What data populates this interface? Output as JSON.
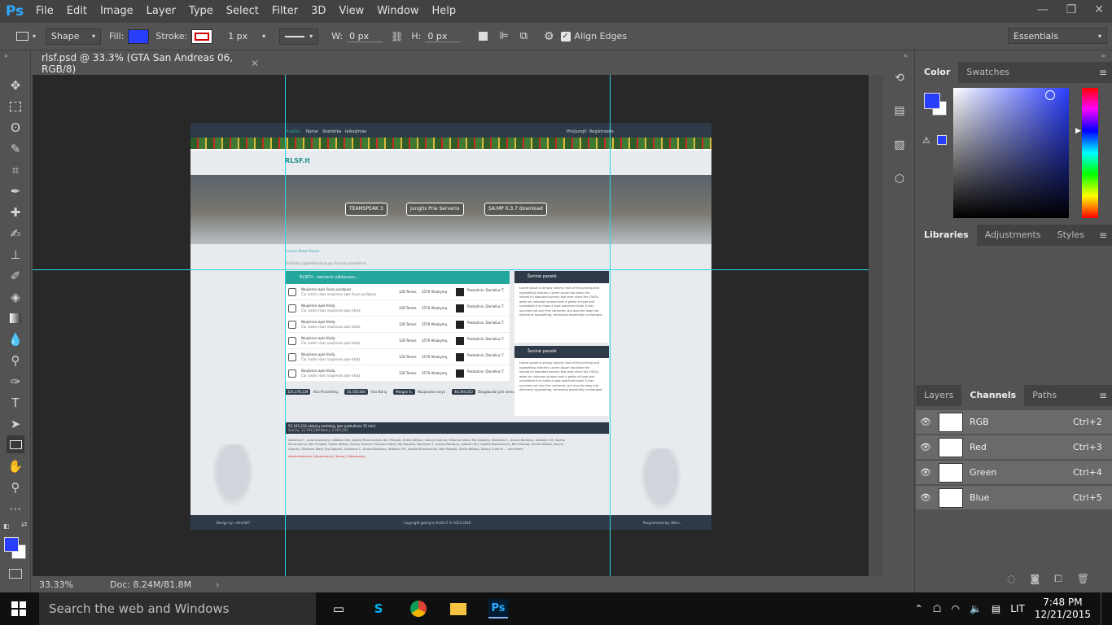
{
  "app": {
    "logo": "Ps",
    "menu": [
      "File",
      "Edit",
      "Image",
      "Layer",
      "Type",
      "Select",
      "Filter",
      "3D",
      "View",
      "Window",
      "Help"
    ]
  },
  "window_controls": {
    "minimize": "—",
    "restore": "❐",
    "close": "✕"
  },
  "options": {
    "tool_mode": "Shape",
    "fill_label": "Fill:",
    "fill_color": "#2a3ffe",
    "stroke_label": "Stroke:",
    "stroke_width": "1 px",
    "w_label": "W:",
    "w_value": "0 px",
    "h_label": "H:",
    "h_value": "0 px",
    "align_edges_label": "Align Edges",
    "workspace": "Essentials"
  },
  "document": {
    "tab_title": "rlsf.psd @ 33.3% (GTA San Andreas 06, RGB/8)",
    "zoom": "33.33%",
    "doc_size": "Doc: 8.24M/81.8M"
  },
  "design": {
    "nav_left": [
      "Pradžia",
      "Nariai",
      "Statistika",
      "Ieškojimas"
    ],
    "nav_right": [
      "Prisijungti",
      "Registruotis"
    ],
    "logo_text": "RLSF.lt",
    "hero_buttons": [
      "TEAMSPEAK 3",
      "Jungtis Prie Serverio",
      "SA:MP 0.3.7 download"
    ],
    "breadcrumb": "Invision Power Board",
    "sub_crumb": "Peržiūrėti pagrindinius/naujus forumo pranešimus",
    "forum_title": "RLSF.lt - serverio užklausos...",
    "forum_rows": [
      {
        "title": "Naujienos apie šiuos puslapius",
        "desc": "Čia rasite visas naujienas apie šiuos puslapius",
        "count": "128 Temos",
        "replies": "2579 Atsakymų",
        "last": "Paskutinis: Danielius T."
      },
      {
        "title": "Naujienos apie tikslą",
        "desc": "Čia rasite visas naujienas apie tikslą",
        "count": "128 Temos",
        "replies": "2579 Atsakymų",
        "last": "Paskutinis: Danielius T."
      },
      {
        "title": "Naujienos apie tikslą",
        "desc": "Čia rasite visas naujienas apie tikslą",
        "count": "128 Temos",
        "replies": "2579 Atsakymų",
        "last": "Paskutinis: Danielius T."
      },
      {
        "title": "Naujienos apie tikslą",
        "desc": "Čia rasite visas naujienas apie tikslą",
        "count": "128 Temos",
        "replies": "2579 Atsakymų",
        "last": "Paskutinis: Danielius T."
      },
      {
        "title": "Naujienos apie tikslą",
        "desc": "Čia rasite visas naujienas apie tikslą",
        "count": "128 Temos",
        "replies": "2579 Atsakymų",
        "last": "Paskutinis: Danielius T."
      },
      {
        "title": "Naujienos apie tikslą",
        "desc": "Čia rasite visas naujienas apie tikslą",
        "count": "128 Temos",
        "replies": "2579 Atsakymų",
        "last": "Paskutinis: Danielius T."
      }
    ],
    "stats": [
      {
        "value": "325,378,129",
        "label": "Viso Pranešimų"
      },
      {
        "value": "35,156,830",
        "label": "Viso Narių"
      },
      {
        "value": "Morgan G.",
        "label": "Naujausias narys"
      },
      {
        "value": "48,294,052",
        "label": "Daugiausiai prie vienu metu"
      }
    ],
    "side_blocks": [
      {
        "title": "Šoninė panelė",
        "body": "Lorem Ipsum is simply dummy text of the printing and typesetting industry. Lorem Ipsum has been the industry's standard dummy text ever since the 1500s, when an unknown printer took a galley of type and scrambled it to make a type specimen book. It has survived not only five centuries, but also the leap into electronic typesetting, remaining essentially unchanged."
      },
      {
        "title": "Šoninė panelė",
        "body": "Lorem Ipsum is simply dummy text of the printing and typesetting industry. Lorem Ipsum has been the industry's standard dummy text ever since the 1500s, when an unknown printer took a galley of type and scrambled it to make a type specimen book. It has survived not only five centuries, but also the leap into electronic typesetting, remaining essentially unchanged."
      }
    ],
    "online_title": "55,105,312 aktyvių vartotojų (per paskutines 15 min)",
    "online_sub": "Svečių: 12,594,289 Narių: 2,993,592",
    "online_body": "Danielius T., Aurora Barawny, Addison Virt, Sophia Murarmanno, Ben Philpott, Shella Willson, Danny Guerrini, Eleanore Ward, Rip Deporto, Danielius T., Aurora Barawny, Addison Virt, Sophia Murarmanno, Ben Philpott, Shella Willson, Danny Guerrini, Eleanore Ward, Rip Deporto, Danielius T., Aurora Barawny, Addison Virt, Sophia Murarmanno, Ben Philpott, Shella Willson, Danny Guerrini, Eleanore Ward, Rip Deporto, Danielius T., Aurora Barawny, Addison Virt, Sophia Murarmanno, Ben Philpott, Shella Willson, Danny Guerrini ... (see More)",
    "legend": "Administratoriai | Moderatoriai | Nariai | Užblokuotas",
    "footer_left": "Design by: vilme987",
    "footer_center": "Copyright galing to RLSF.LT © 2015-2016",
    "footer_right": "Programmed by: Wiler..."
  },
  "panels": {
    "color_tabs": [
      "Color",
      "Swatches"
    ],
    "foreground_color": "#2a3ffe",
    "libraries_tabs": [
      "Libraries",
      "Adjustments",
      "Styles"
    ],
    "layer_tabs": [
      "Layers",
      "Channels",
      "Paths"
    ],
    "channels": [
      {
        "name": "RGB",
        "key": "Ctrl+2"
      },
      {
        "name": "Red",
        "key": "Ctrl+3"
      },
      {
        "name": "Green",
        "key": "Ctrl+4"
      },
      {
        "name": "Blue",
        "key": "Ctrl+5"
      }
    ]
  },
  "taskbar": {
    "search_placeholder": "Search the web and Windows",
    "language": "LIT",
    "time": "7:48 PM",
    "date": "12/21/2015"
  }
}
